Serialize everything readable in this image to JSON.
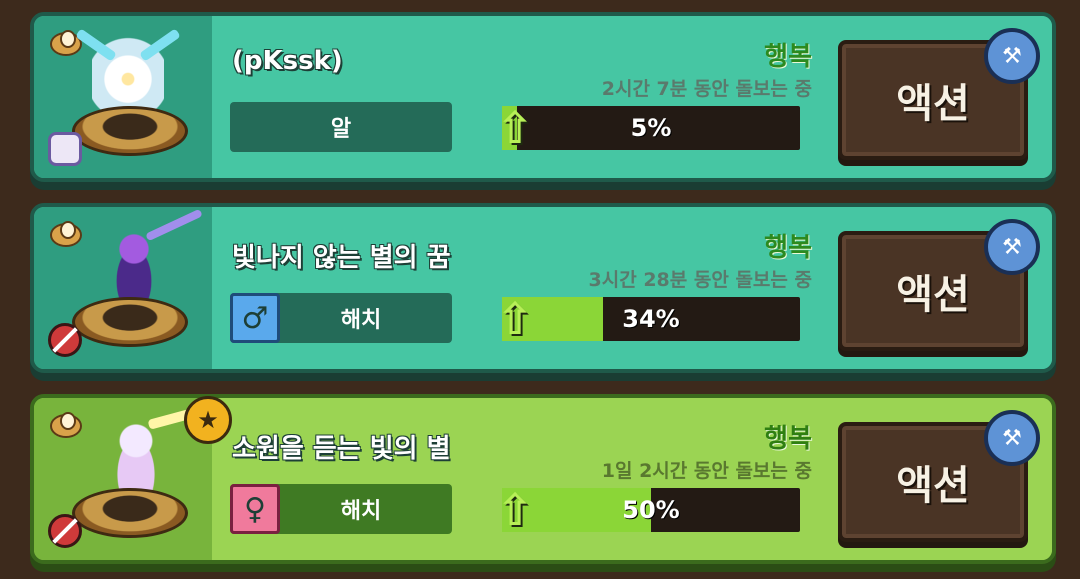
{
  "pets": [
    {
      "name": "(pKssk)",
      "stage_label": "알",
      "gender": null,
      "mood_label": "행복",
      "care_text": "2시간 7분 동안 돌보는 중",
      "progress_text": "5%",
      "progress": 0.05,
      "action_label": "액션",
      "favorite": false,
      "portrait_icon": "egg-creature",
      "side_icon": "shoe-icon"
    },
    {
      "name": "빛나지 않는 별의 꿈",
      "stage_label": "해치",
      "gender": "male",
      "gender_symbol": "♂",
      "mood_label": "행복",
      "care_text": "3시간 28분 동안 돌보는 중",
      "progress_text": "34%",
      "progress": 0.34,
      "action_label": "액션",
      "favorite": false,
      "portrait_icon": "dark-creature",
      "side_icon": "no-entry-icon"
    },
    {
      "name": "소원을 듣는 빛의 별",
      "stage_label": "해치",
      "gender": "female",
      "gender_symbol": "♀",
      "mood_label": "행복",
      "care_text": "1일 2시간 동안 돌보는 중",
      "progress_text": "50%",
      "progress": 0.5,
      "action_label": "액션",
      "favorite": true,
      "favorite_symbol": "★",
      "portrait_icon": "light-creature",
      "side_icon": "no-entry-icon"
    }
  ],
  "icons": {
    "up_arrow": "⇧",
    "wrench": "🔧"
  },
  "colors": {
    "card_bg": "#46c6a3",
    "gold_card_bg": "#9bd453",
    "progress_fill": "#8bd637",
    "action_button": "#4a3425"
  }
}
